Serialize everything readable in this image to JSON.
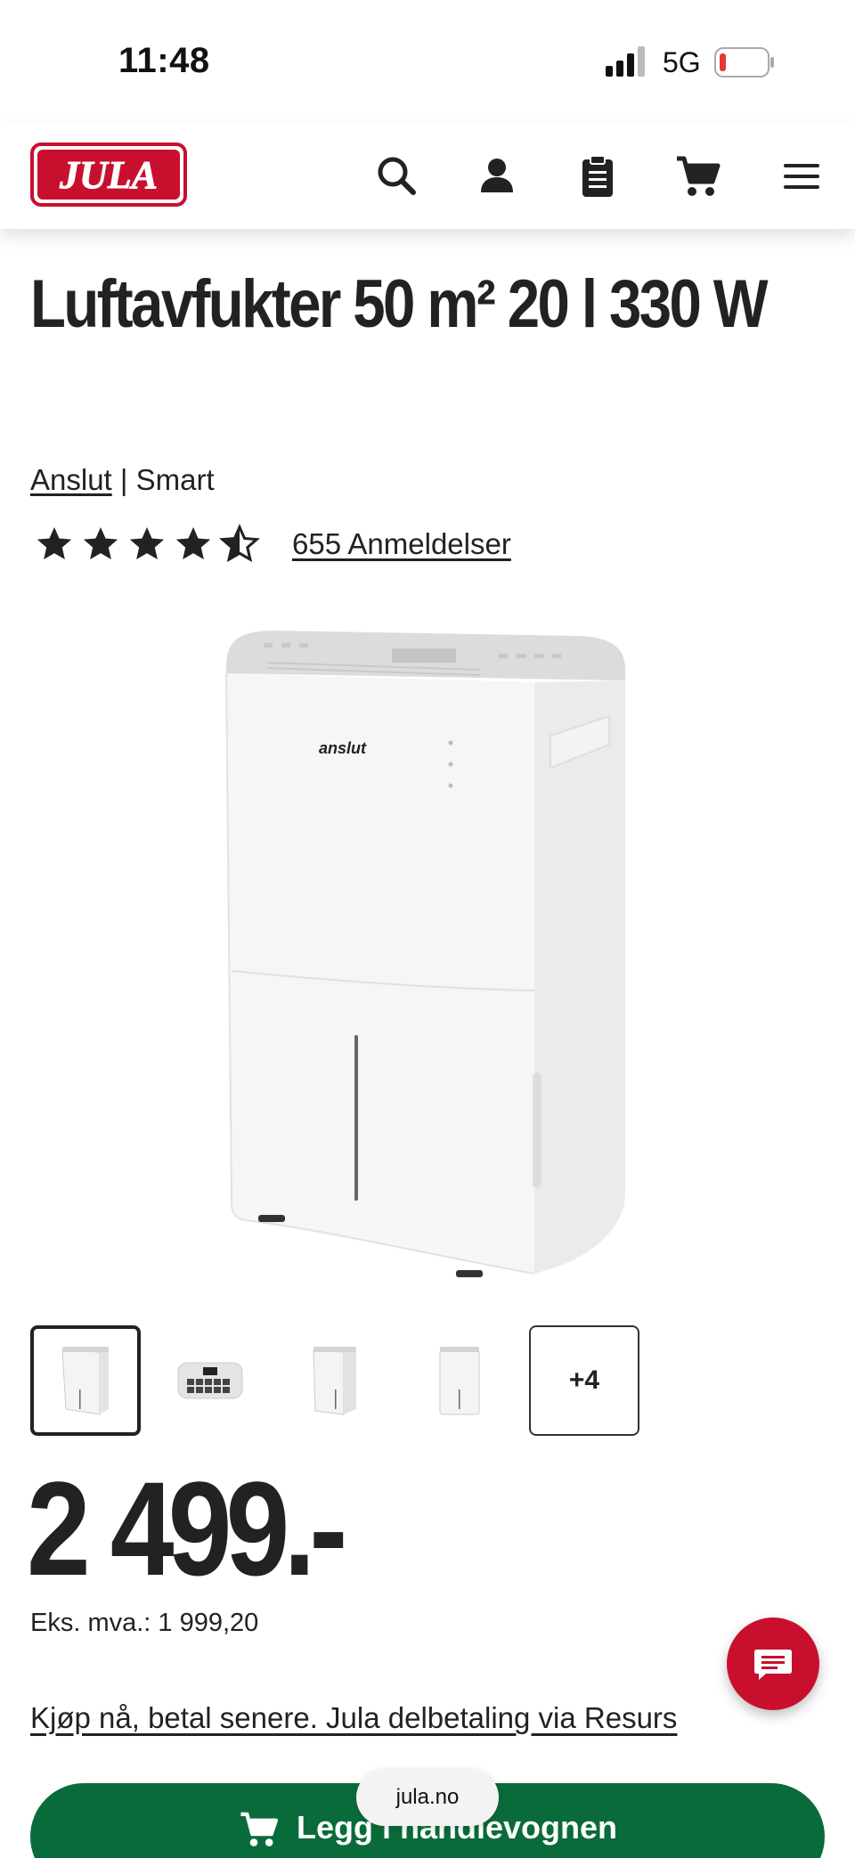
{
  "status_bar": {
    "time": "11:48",
    "network": "5G",
    "battery_color": "#e53935"
  },
  "header": {
    "logo_text": "JULA",
    "brand_color": "#c8102e",
    "icons": [
      "search-icon",
      "account-icon",
      "clipboard-list-icon",
      "cart-icon",
      "menu-icon"
    ]
  },
  "product": {
    "title": "Luftavfukter 50 m² 20 l 330 W",
    "brand": "Anslut",
    "separator": "|",
    "series": "Smart",
    "rating": 4.5,
    "reviews_label": "655 Anmeldelser",
    "device_logo": "anslut",
    "thumbnails_more": "+4"
  },
  "pricing": {
    "price": "2 499.-",
    "ex_vat": "Eks. mva.: 1 999,20",
    "finance_link": "Kjøp nå, betal senere. Jula delbetaling via Resurs"
  },
  "actions": {
    "add_to_cart": "Legg i handlevognen",
    "cart_button_color": "#0a6b3a"
  },
  "browser": {
    "url": "jula.no"
  }
}
